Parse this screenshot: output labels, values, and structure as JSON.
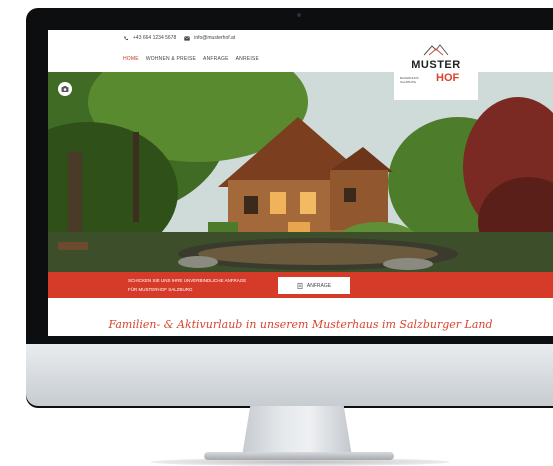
{
  "header": {
    "phone": "+43 664 1234 5678",
    "email": "info@musterhof.at",
    "nav": [
      {
        "label": "HOME",
        "active": true
      },
      {
        "label": "WOHNEN & PREISE",
        "active": false
      },
      {
        "label": "ANFRAGE",
        "active": false
      },
      {
        "label": "ANREISE",
        "active": false
      }
    ]
  },
  "logo": {
    "line1": "MUSTER",
    "line2_small": "BAUERNHOF SALZBURG",
    "line2": "HOF"
  },
  "banner": {
    "text_line1": "SCHICKEN SIE UNS IHRE UNVERBINDLICHE ANFRAGE",
    "text_line2": "FÜR MUSTERHOF SALZBURG",
    "button_label": "ANFRAGE"
  },
  "tagline": "Familien- & Aktivurlaub in unserem Musterhaus im Salzburger Land",
  "colors": {
    "accent": "#d63b2a",
    "bezel": "#0d0e10"
  }
}
